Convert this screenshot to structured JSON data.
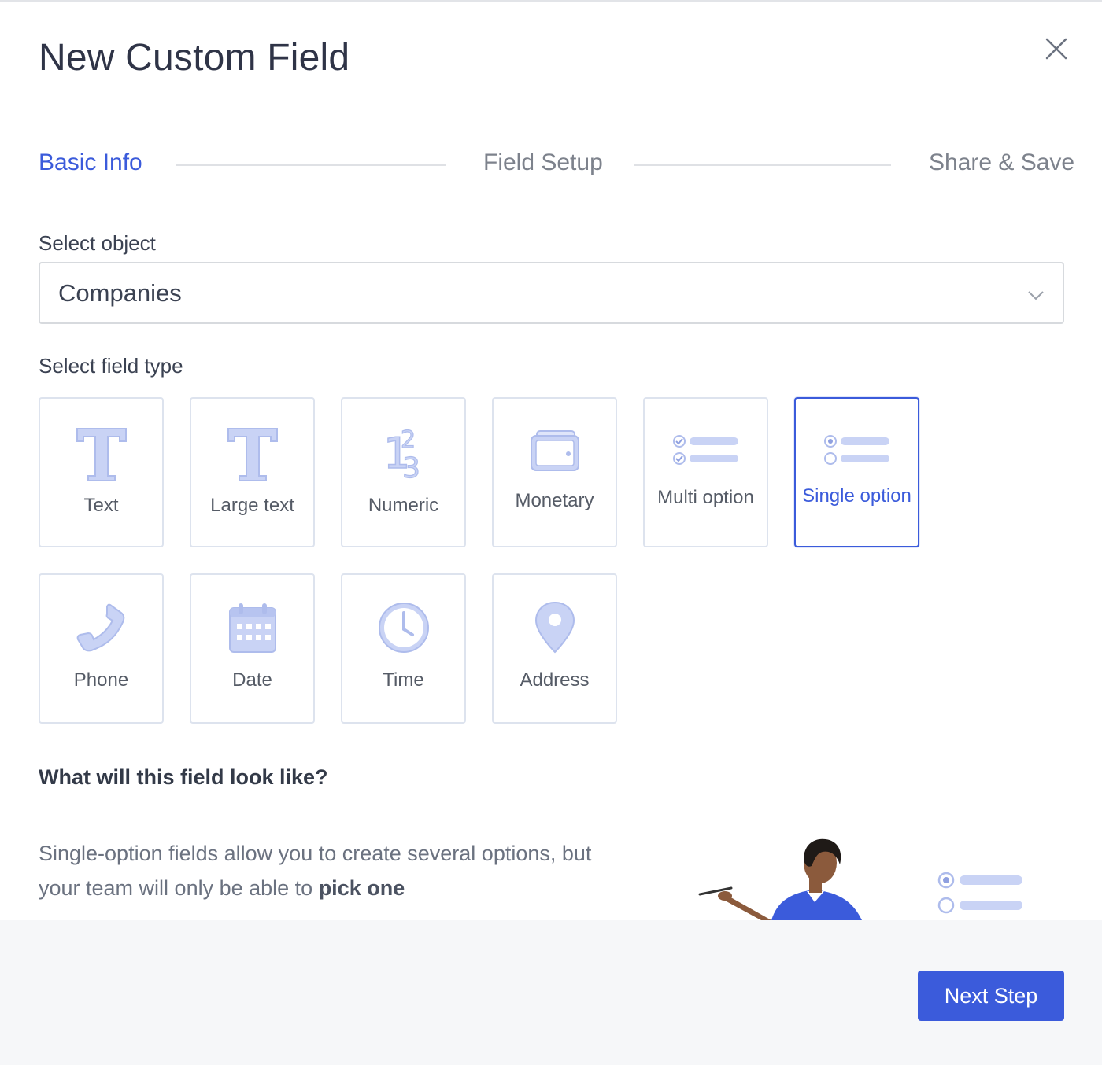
{
  "modal": {
    "title": "New Custom Field",
    "close_icon": "close-icon"
  },
  "steps": [
    {
      "label": "Basic Info",
      "active": true
    },
    {
      "label": "Field Setup",
      "active": false
    },
    {
      "label": "Share & Save",
      "active": false
    }
  ],
  "select_object": {
    "label": "Select object",
    "value": "Companies",
    "icon": "chevron-down-icon"
  },
  "field_type": {
    "label": "Select field type",
    "selected": "Single option",
    "options": [
      {
        "label": "Text",
        "icon": "text-icon"
      },
      {
        "label": "Large text",
        "icon": "large-text-icon"
      },
      {
        "label": "Numeric",
        "icon": "numeric-icon"
      },
      {
        "label": "Monetary",
        "icon": "wallet-icon"
      },
      {
        "label": "Multi option",
        "icon": "multi-option-icon"
      },
      {
        "label": "Single option",
        "icon": "single-option-icon"
      },
      {
        "label": "Phone",
        "icon": "phone-icon"
      },
      {
        "label": "Date",
        "icon": "calendar-icon"
      },
      {
        "label": "Time",
        "icon": "clock-icon"
      },
      {
        "label": "Address",
        "icon": "map-pin-icon"
      }
    ]
  },
  "preview": {
    "heading": "What will this field look like?",
    "description_prefix": "Single-option fields allow you to create several options, but your team will only be able to ",
    "description_bold": "pick one"
  },
  "footer": {
    "next_label": "Next Step"
  },
  "colors": {
    "accent": "#3b5bdb",
    "icon_fill": "#c9d3f5",
    "icon_stroke": "#aebcec",
    "border": "#dde3ee",
    "footer_bg": "#f6f7f9"
  }
}
